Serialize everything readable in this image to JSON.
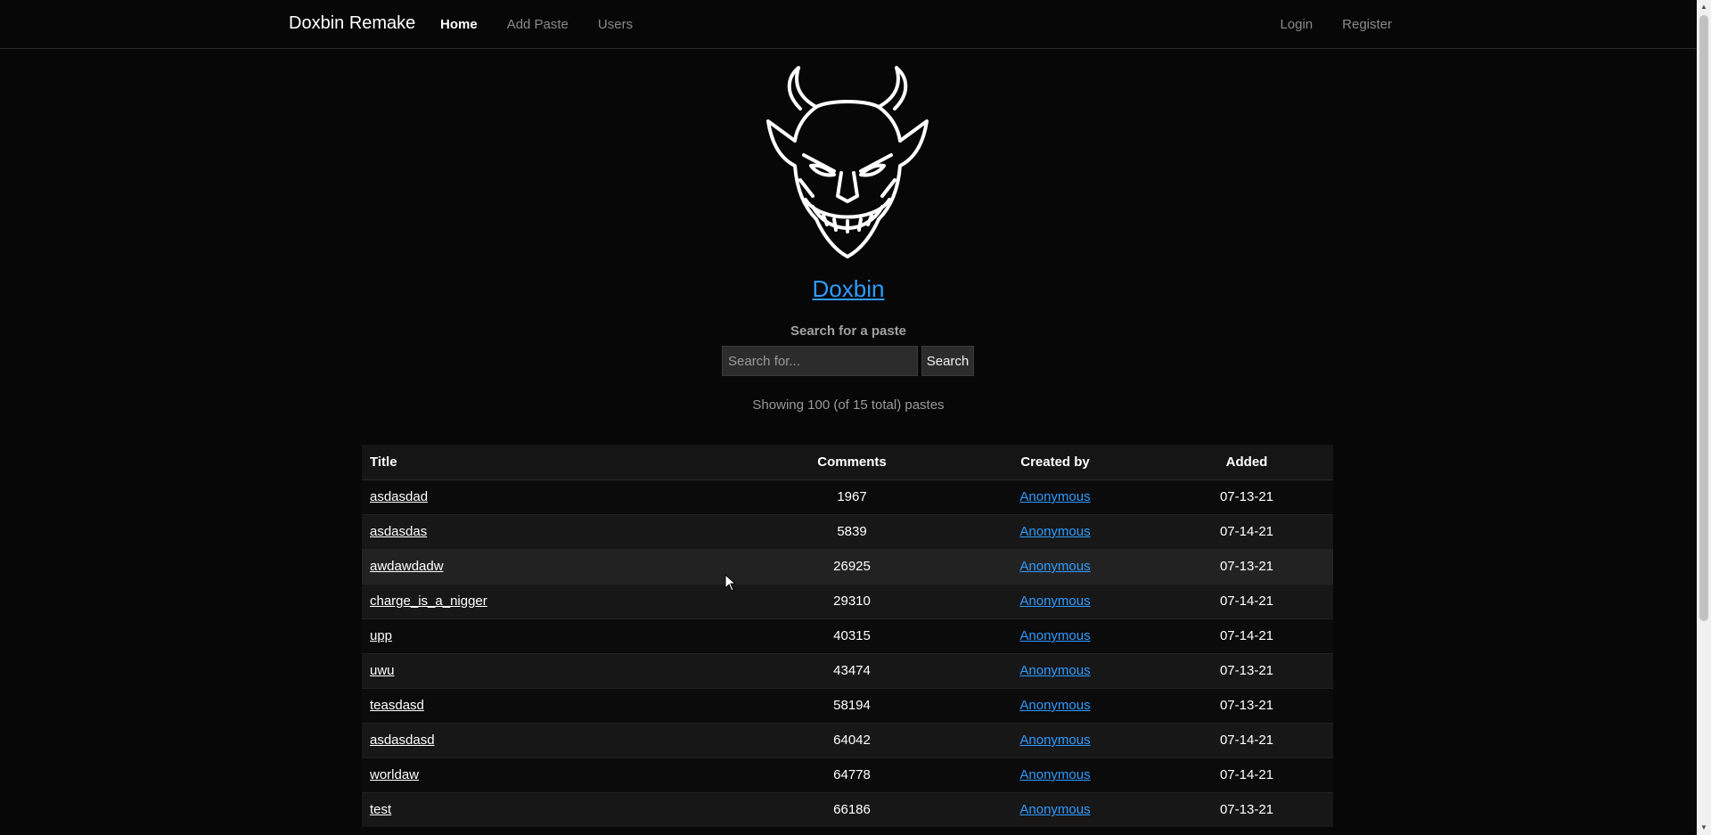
{
  "navbar": {
    "brand": "Doxbin Remake",
    "left_links": [
      {
        "label": "Home",
        "active": true
      },
      {
        "label": "Add Paste",
        "active": false
      },
      {
        "label": "Users",
        "active": false
      }
    ],
    "right_links": [
      {
        "label": "Login"
      },
      {
        "label": "Register"
      }
    ]
  },
  "hero": {
    "logo_icon": "demon-face-icon",
    "title": "Doxbin",
    "search_label": "Search for a paste",
    "search_placeholder": "Search for...",
    "search_value": "",
    "search_button": "Search",
    "showing_text": "Showing 100 (of 15 total) pastes"
  },
  "table": {
    "headers": {
      "title": "Title",
      "comments": "Comments",
      "created_by": "Created by",
      "added": "Added"
    },
    "rows": [
      {
        "title": "asdasdad",
        "comments": "1967",
        "created_by": "Anonymous",
        "added": "07-13-21"
      },
      {
        "title": "asdasdas",
        "comments": "5839",
        "created_by": "Anonymous",
        "added": "07-14-21"
      },
      {
        "title": "awdawdadw",
        "comments": "26925",
        "created_by": "Anonymous",
        "added": "07-13-21"
      },
      {
        "title": "charge_is_a_nigger",
        "comments": "29310",
        "created_by": "Anonymous",
        "added": "07-14-21"
      },
      {
        "title": "upp",
        "comments": "40315",
        "created_by": "Anonymous",
        "added": "07-14-21"
      },
      {
        "title": "uwu",
        "comments": "43474",
        "created_by": "Anonymous",
        "added": "07-13-21"
      },
      {
        "title": "teasdasd",
        "comments": "58194",
        "created_by": "Anonymous",
        "added": "07-13-21"
      },
      {
        "title": "asdasdasd",
        "comments": "64042",
        "created_by": "Anonymous",
        "added": "07-14-21"
      },
      {
        "title": "worldaw",
        "comments": "64778",
        "created_by": "Anonymous",
        "added": "07-14-21"
      },
      {
        "title": "test",
        "comments": "66186",
        "created_by": "Anonymous",
        "added": "07-13-21"
      }
    ]
  },
  "colors": {
    "background": "#070707",
    "link_blue": "#2f9bff",
    "header_bg": "#151515",
    "row_alt_bg": "#171717"
  }
}
